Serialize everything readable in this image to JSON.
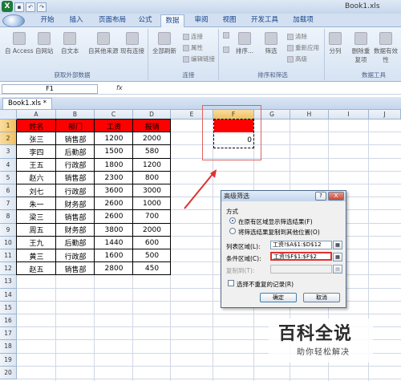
{
  "window": {
    "title": "Book1.xls"
  },
  "quick_access": [
    "save-icon",
    "undo-icon",
    "redo-icon"
  ],
  "tabs": [
    {
      "label": "开始",
      "active": false
    },
    {
      "label": "插入",
      "active": false
    },
    {
      "label": "页面布局",
      "active": false
    },
    {
      "label": "公式",
      "active": false
    },
    {
      "label": "数据",
      "active": true
    },
    {
      "label": "审阅",
      "active": false
    },
    {
      "label": "视图",
      "active": false
    },
    {
      "label": "开发工具",
      "active": false
    },
    {
      "label": "加载项",
      "active": false
    }
  ],
  "ribbon": {
    "external": {
      "access": "自 Access",
      "web": "自网站",
      "text": "自文本",
      "other": "自其他来源",
      "existing": "现有连接",
      "group": "获取外部数据"
    },
    "connections": {
      "refresh_all": "全部刷新",
      "connections": "连接",
      "properties": "属性",
      "edit_links": "编辑链接",
      "group": "连接"
    },
    "sort_filter": {
      "sort": "排序...",
      "filter": "筛选",
      "clear": "清除",
      "reapply": "重新应用",
      "advanced": "高级",
      "group": "排序和筛选"
    },
    "data_tools": {
      "split": "分列",
      "remove_dup": "删除重复项",
      "validation": "数据有效性",
      "group": "数据工具"
    }
  },
  "formula_bar": {
    "name_box": "F1",
    "fx": "fx",
    "value": ""
  },
  "workbook_tab": {
    "label": "Book1.xls *"
  },
  "columns": [
    "A",
    "B",
    "C",
    "D",
    "E",
    "F",
    "G",
    "H",
    "I",
    "J"
  ],
  "rows": [
    "1",
    "2",
    "3",
    "4",
    "5",
    "6",
    "7",
    "8",
    "9",
    "10",
    "11",
    "12",
    "13",
    "14",
    "15",
    "16",
    "17",
    "18",
    "19",
    "20"
  ],
  "table": {
    "headers": [
      "姓名",
      "部门",
      "工资",
      "报销"
    ],
    "rows": [
      [
        "张三",
        "销售部",
        "1200",
        "2000"
      ],
      [
        "李四",
        "后勤部",
        "1500",
        "580"
      ],
      [
        "王五",
        "行政部",
        "1800",
        "1200"
      ],
      [
        "赵六",
        "销售部",
        "2300",
        "800"
      ],
      [
        "刘七",
        "行政部",
        "3600",
        "3000"
      ],
      [
        "朱一",
        "财务部",
        "2600",
        "1000"
      ],
      [
        "梁三",
        "销售部",
        "2600",
        "700"
      ],
      [
        "周五",
        "财务部",
        "3800",
        "2000"
      ],
      [
        "王九",
        "后勤部",
        "1440",
        "600"
      ],
      [
        "黄三",
        "行政部",
        "1600",
        "500"
      ],
      [
        "赵五",
        "销售部",
        "2800",
        "450"
      ]
    ]
  },
  "criteria": {
    "f2": "0"
  },
  "dialog": {
    "title": "高级筛选",
    "help": "?",
    "close": "X",
    "method_label": "方式",
    "option_inplace": "在原有区域显示筛选结果(F)",
    "option_copy": "将筛选结果复制到其他位置(O)",
    "list_range_label": "列表区域(L):",
    "list_range_value": "工资!$A$1:$D$12",
    "criteria_label": "条件区域(C):",
    "criteria_value": "工资!$F$1:$F$2",
    "copy_to_label": "复制到(T):",
    "copy_to_value": "",
    "unique_label": "选择不重复的记录(R)",
    "ok": "确定",
    "cancel": "取消"
  },
  "watermark": {
    "title": "百科全说",
    "subtitle": "助你轻松解决"
  },
  "colors": {
    "header_fill": "#ff0000",
    "highlight_box": "#e06060",
    "arrow": "#e03030"
  }
}
